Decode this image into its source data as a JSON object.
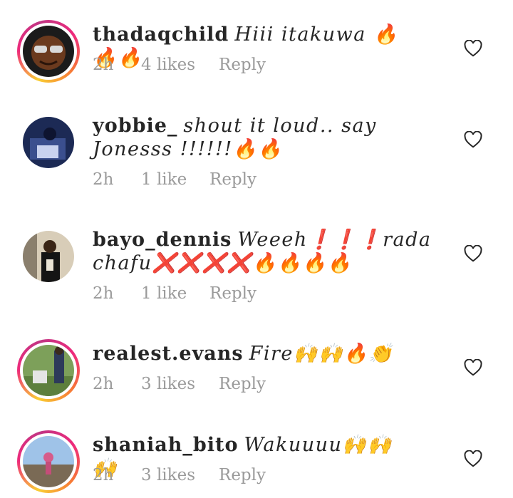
{
  "comments": [
    {
      "username": "thadaqchild",
      "text": "Hiii itakuwa 🔥🔥🔥",
      "time": "2h",
      "likes": "4 likes",
      "reply": "Reply"
    },
    {
      "username": "yobbie_",
      "text": "shout it loud.. say Jonesss !!!!!!🔥🔥",
      "time": "2h",
      "likes": "1 like",
      "reply": "Reply"
    },
    {
      "username": "bayo_dennis",
      "text": "Weeeh❗❗❗rada chafu❌❌❌❌🔥🔥🔥🔥",
      "time": "2h",
      "likes": "1 like",
      "reply": "Reply"
    },
    {
      "username": "realest.evans",
      "text": "Fire🙌🙌🔥👏",
      "time": "2h",
      "likes": "3 likes",
      "reply": "Reply"
    },
    {
      "username": "shaniah_bito",
      "text": "Wakuuuu🙌🙌🙌",
      "time": "2h",
      "likes": "3 likes",
      "reply": "Reply"
    }
  ],
  "icons": {
    "like": "heart-outline-icon"
  }
}
